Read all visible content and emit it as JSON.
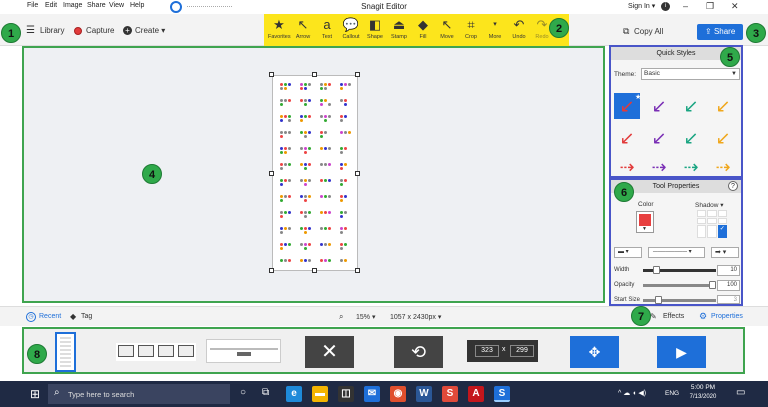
{
  "menubar": {
    "items": [
      "File",
      "Edit",
      "Image",
      "Share",
      "View",
      "Help"
    ],
    "app_title": "Snagit Editor",
    "sign_in": "Sign In ▾"
  },
  "toolbar": {
    "library": "Library",
    "capture": "Capture",
    "create": "Create ▾",
    "tools": [
      {
        "label": "Favorites",
        "icon": "star-icon"
      },
      {
        "label": "Arrow",
        "icon": "arrow-icon"
      },
      {
        "label": "Text",
        "icon": "text-icon"
      },
      {
        "label": "Callout",
        "icon": "callout-icon"
      },
      {
        "label": "Shape",
        "icon": "shape-icon"
      },
      {
        "label": "Stamp",
        "icon": "stamp-icon"
      },
      {
        "label": "Fill",
        "icon": "fill-icon"
      },
      {
        "label": "Move",
        "icon": "move-icon"
      },
      {
        "label": "Crop",
        "icon": "crop-icon"
      },
      {
        "label": "More",
        "icon": "more-icon"
      },
      {
        "label": "Undo",
        "icon": "undo-icon"
      },
      {
        "label": "Redo",
        "icon": "redo-icon"
      }
    ],
    "copy_all": "Copy All",
    "share": "Share"
  },
  "badges": {
    "b1": "1",
    "b2": "2",
    "b3": "3",
    "b4": "4",
    "b5": "5",
    "b6": "6",
    "b7": "7",
    "b8": "8"
  },
  "quick_styles": {
    "title": "Quick Styles",
    "theme_label": "Theme:",
    "theme_value": "Basic"
  },
  "tool_properties": {
    "title": "Tool Properties",
    "help": "?",
    "color_label": "Color",
    "shadow_label": "Shadow ▾",
    "width_label": "Width",
    "width_value": "10",
    "opacity_label": "Opacity",
    "opacity_value": "100",
    "start_size_label": "Start Size",
    "start_size_value": "3"
  },
  "statusbar": {
    "recent": "Recent",
    "tag": "Tag",
    "zoom": "15% ▾",
    "dimensions": "1057 x 2430px ▾",
    "effects": "Effects",
    "properties": "Properties"
  },
  "tray": {
    "resize_w": "323",
    "resize_x": "x",
    "resize_h": "299"
  },
  "taskbar": {
    "search_placeholder": "Type here to search",
    "lang": "ENG",
    "time": "5:00 PM",
    "date": "7/13/2020"
  },
  "colors": {
    "accent_yellow": "#fce51c",
    "badge_green": "#2fa94a",
    "share_blue": "#1e6fd9",
    "panel_border": "#4955c8"
  }
}
